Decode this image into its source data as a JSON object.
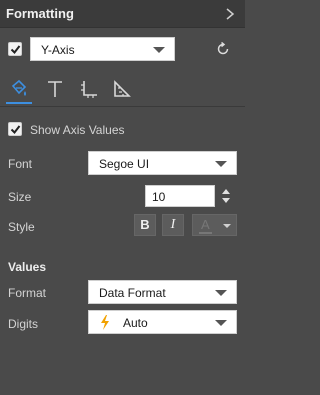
{
  "header": {
    "title": "Formatting",
    "expand_icon": "chevron-right-icon"
  },
  "axis_selector": {
    "checked": true,
    "value": "Y-Axis",
    "reset_icon": "refresh-icon"
  },
  "tabs": [
    {
      "name": "paint-format-icon",
      "active": true
    },
    {
      "name": "text-icon",
      "active": false
    },
    {
      "name": "axis-icon",
      "active": false
    },
    {
      "name": "ruler-icon",
      "active": false
    }
  ],
  "show_axis_values": {
    "checked": true,
    "label": "Show Axis Values"
  },
  "font": {
    "label": "Font",
    "value": "Segoe UI"
  },
  "size": {
    "label": "Size",
    "value": "10"
  },
  "style": {
    "label": "Style",
    "bold": "B",
    "italic": "I",
    "color_letter": "A"
  },
  "values_section": {
    "title": "Values"
  },
  "format": {
    "label": "Format",
    "value": "Data Format"
  },
  "digits": {
    "label": "Digits",
    "value": "Auto",
    "icon": "lightning-icon"
  },
  "colors": {
    "accent": "#3d8fe0",
    "panel": "#4a4a4a",
    "header": "#3b3b3b",
    "lightning": "#f2a100"
  }
}
